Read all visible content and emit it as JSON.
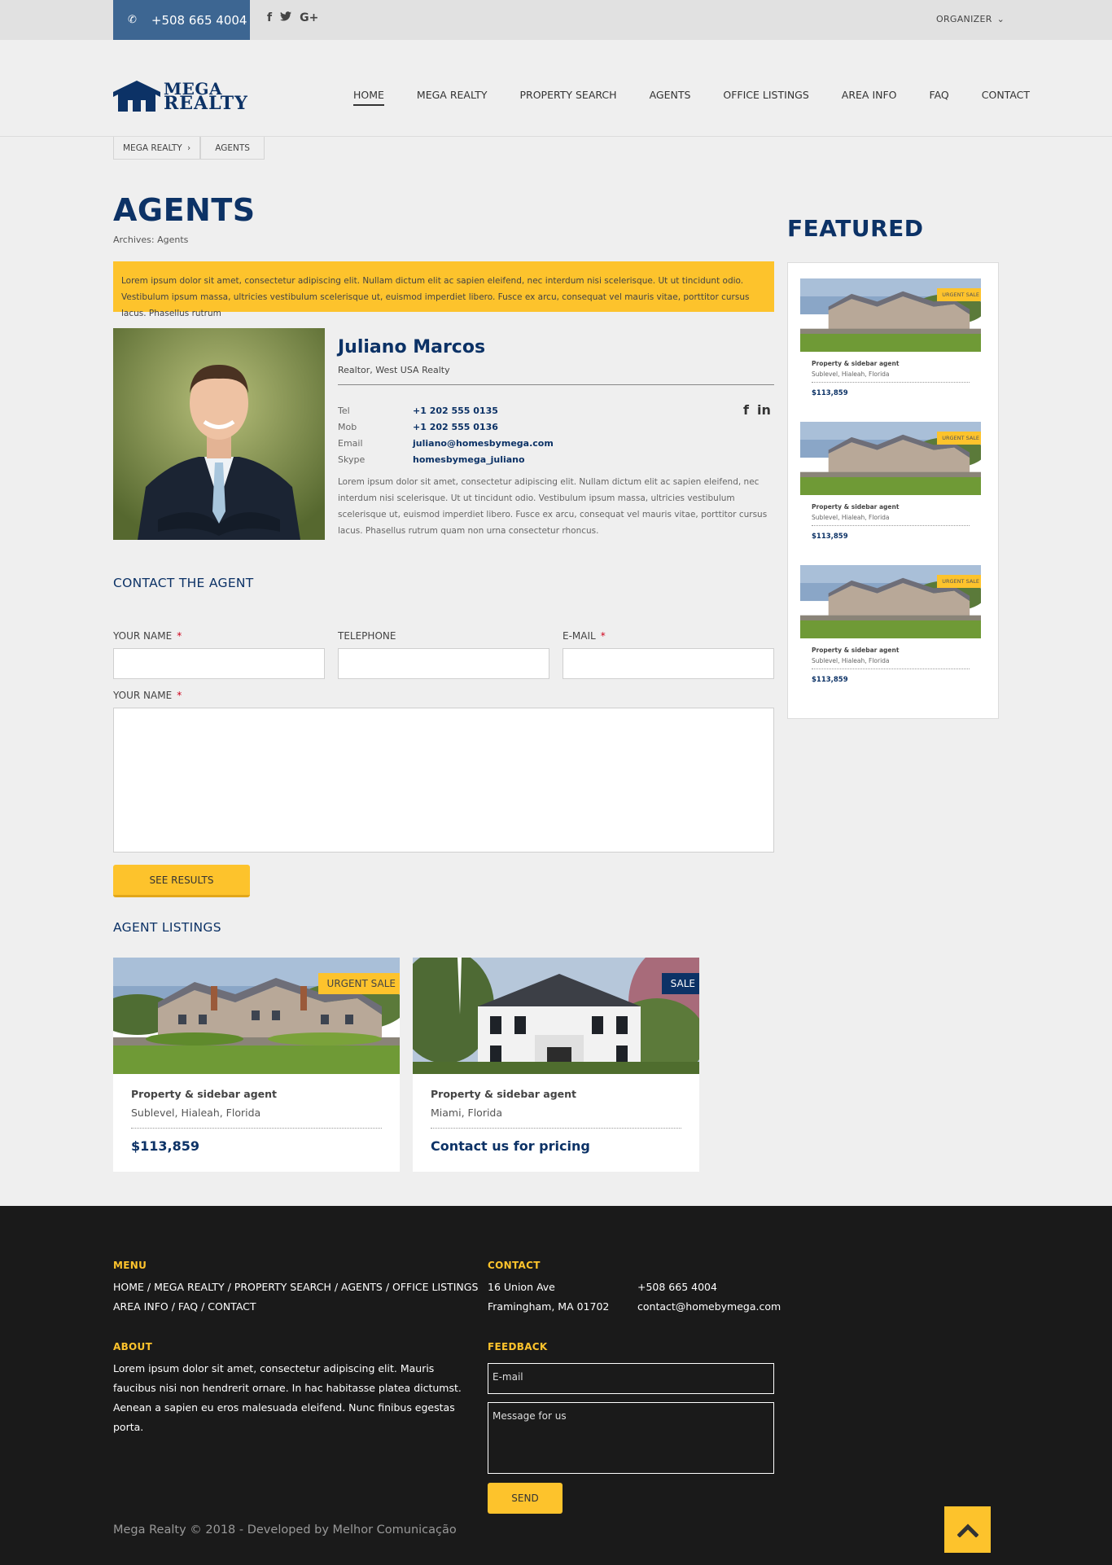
{
  "topbar": {
    "phone": "+508 665 4004",
    "social_icons": [
      "facebook-icon",
      "twitter-icon",
      "google-plus-icon"
    ],
    "organizer": "ORGANIZER"
  },
  "logo": {
    "line1": "MEGA",
    "line2": "REALTY"
  },
  "nav": {
    "items": [
      "HOME",
      "MEGA REALTY",
      "PROPERTY SEARCH",
      "AGENTS",
      "OFFICE LISTINGS",
      "AREA INFO",
      "FAQ",
      "CONTACT"
    ],
    "active": "HOME"
  },
  "breadcrumb": [
    "MEGA REALTY",
    "AGENTS"
  ],
  "page": {
    "title": "AGENTS",
    "archives": "Archives: Agents",
    "notice": "Lorem ipsum dolor sit amet, consectetur adipiscing elit. Nullam dictum elit ac sapien eleifend, nec interdum nisi scelerisque. Ut ut tincidunt odio. Vestibulum ipsum massa, ultricies vestibulum scelerisque ut, euismod imperdiet libero. Fusce ex arcu, consequat vel mauris vitae, porttitor cursus lacus. Phasellus rutrum"
  },
  "agent": {
    "name": "Juliano Marcos",
    "role": "Realtor, West USA Realty",
    "contacts": [
      {
        "label": "Tel",
        "value": "+1 202 555 0135"
      },
      {
        "label": "Mob",
        "value": "+1 202 555 0136"
      },
      {
        "label": "Email",
        "value": "juliano@homesbymega.com"
      },
      {
        "label": "Skype",
        "value": "homesbymega_juliano"
      }
    ],
    "bio": "Lorem ipsum dolor sit amet, consectetur adipiscing elit. Nullam dictum elit ac sapien eleifend, nec interdum nisi scelerisque. Ut ut tincidunt odio. Vestibulum ipsum massa, ultricies vestibulum scelerisque ut, euismod imperdiet libero. Fusce ex arcu, consequat vel mauris vitae, porttitor cursus lacus. Phasellus rutrum quam non urna consectetur rhoncus."
  },
  "contact_form": {
    "heading": "CONTACT THE AGENT",
    "name_label": "YOUR NAME",
    "phone_label": "TELEPHONE",
    "email_label": "E-MAIL",
    "message_label": "YOUR NAME",
    "required_mark": "*",
    "submit": "SEE RESULTS"
  },
  "listings": {
    "heading": "AGENT LISTINGS",
    "items": [
      {
        "tag": "URGENT SALE",
        "title": "Property & sidebar agent",
        "location": "Sublevel, Hialeah, Florida",
        "price": "$113,859"
      },
      {
        "tag": "SALE",
        "title": "Property & sidebar agent",
        "location": "Miami, Florida",
        "price": "Contact us for pricing"
      }
    ]
  },
  "featured": {
    "heading": "FEATURED",
    "items": [
      {
        "tag": "URGENT SALE",
        "title": "Property & sidebar agent",
        "location": "Sublevel, Hialeah, Florida",
        "price": "$113,859"
      },
      {
        "tag": "URGENT SALE",
        "title": "Property & sidebar agent",
        "location": "Sublevel, Hialeah, Florida",
        "price": "$113,859"
      },
      {
        "tag": "URGENT SALE",
        "title": "Property & sidebar agent",
        "location": "Sublevel, Hialeah, Florida",
        "price": "$113,859"
      }
    ]
  },
  "footer": {
    "menu_heading": "MENU",
    "menu_line1": "HOME / MEGA REALTY / PROPERTY SEARCH / AGENTS / OFFICE LISTINGS",
    "menu_line2": "AREA INFO / FAQ / CONTACT",
    "about_heading": "ABOUT",
    "about_text": "Lorem ipsum dolor sit amet, consectetur adipiscing elit. Mauris faucibus nisi non hendrerit ornare. In hac habitasse platea dictumst. Aenean a sapien eu eros malesuada eleifend. Nunc finibus egestas porta.",
    "contact_heading": "CONTACT",
    "address1": "16 Union Ave",
    "address2": "Framingham, MA 01702",
    "phone": "+508 665 4004",
    "email": "contact@homebymega.com",
    "feedback_heading": "FEEDBACK",
    "email_placeholder": "E-mail",
    "message_placeholder": "Message for us",
    "send": "SEND",
    "copyright": "Mega Realty © 2018 - Developed by Melhor Comunicação"
  },
  "colors": {
    "brand_navy": "#0c3266",
    "accent_yellow": "#fdc32c",
    "phone_blue": "#3d6692",
    "footer_bg": "#1a1a1a"
  }
}
